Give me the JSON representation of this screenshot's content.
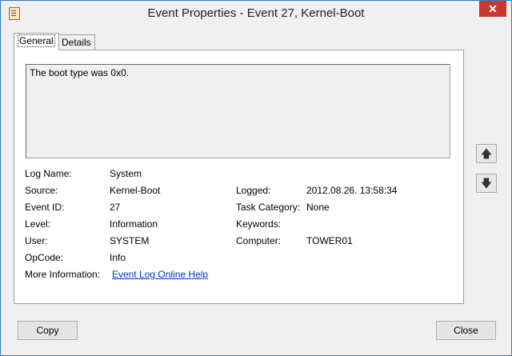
{
  "window": {
    "title": "Event Properties - Event 27, Kernel-Boot",
    "close_glyph": "✕"
  },
  "tabs": [
    {
      "label": "General"
    },
    {
      "label": "Details"
    }
  ],
  "description": "The boot type was 0x0.",
  "fields": {
    "log_name": {
      "label": "Log Name:",
      "value": "System"
    },
    "source": {
      "label": "Source:",
      "value": "Kernel-Boot"
    },
    "logged": {
      "label": "Logged:",
      "value": "2012.08.26. 13:58:34"
    },
    "event_id": {
      "label": "Event ID:",
      "value": "27"
    },
    "task_category": {
      "label": "Task Category:",
      "value": "None"
    },
    "level": {
      "label": "Level:",
      "value": "Information"
    },
    "keywords": {
      "label": "Keywords:",
      "value": ""
    },
    "user": {
      "label": "User:",
      "value": "SYSTEM"
    },
    "computer": {
      "label": "Computer:",
      "value": "TOWER01"
    },
    "opcode": {
      "label": "OpCode:",
      "value": "Info"
    },
    "more_info": {
      "label": "More Information:",
      "value": "Event Log Online Help"
    }
  },
  "buttons": {
    "copy": "Copy",
    "close": "Close"
  },
  "icons": {
    "up": "up-arrow-icon",
    "down": "down-arrow-icon"
  },
  "colors": {
    "close_button": "#c7382e",
    "link": "#0033cc",
    "window_border": "#2a7fd4"
  }
}
